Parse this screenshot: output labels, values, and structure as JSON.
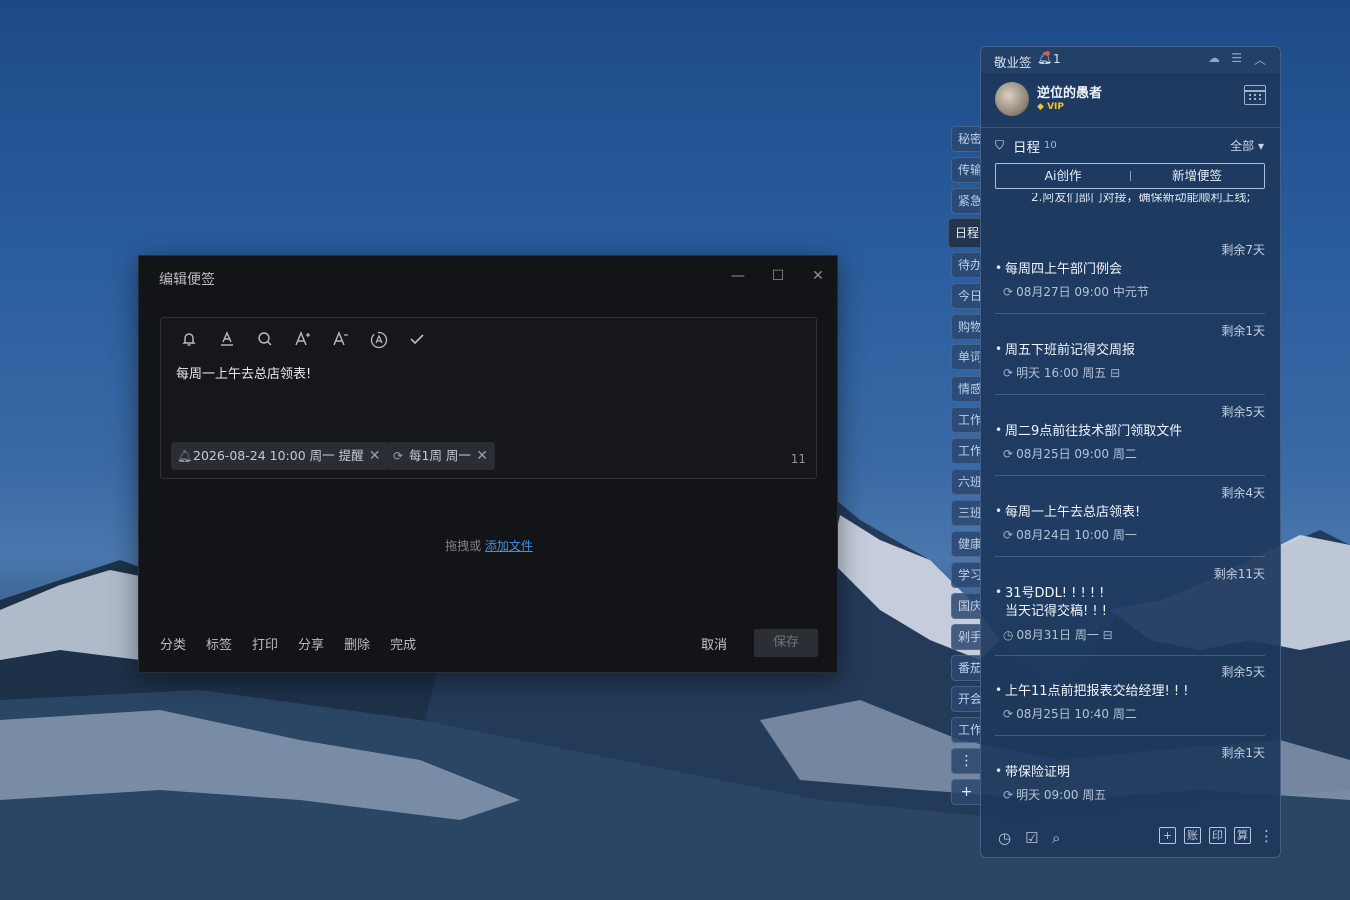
{
  "editor": {
    "title": "编辑便签",
    "minimize_icon": "minimize-icon",
    "maximize_icon": "maximize-icon",
    "close_icon": "close-icon",
    "toolbar": [
      "bell-icon",
      "text-underline-icon",
      "search-icon",
      "font-increase-icon",
      "font-decrease-icon",
      "ai-circle-icon",
      "check-icon"
    ],
    "content": "每周一上午去总店领表!",
    "reminder_chip": "2026-08-24 10:00 周一 提醒",
    "repeat_chip": "每1周 周一",
    "char_count": "11",
    "drop_hint": "拖拽或",
    "add_file_link": "添加文件",
    "actions": [
      "分类",
      "标签",
      "打印",
      "分享",
      "删除",
      "完成"
    ],
    "cancel_label": "取消",
    "save_label": "保存"
  },
  "side_tabs": [
    "秘密",
    "传输",
    "紧急",
    "日程",
    "待办",
    "今日",
    "购物",
    "单词",
    "情感",
    "工作",
    "工作",
    "六班",
    "三班",
    "健康",
    "学习",
    "国庆",
    "剁手",
    "番茄",
    "开会",
    "工作",
    "⋮",
    "+"
  ],
  "side_tab_active": "日程",
  "panel": {
    "app_name": "敬业签",
    "notification_count": "1",
    "username": "逆位的愚者",
    "vip_label": "VIP",
    "schedule_label": "日程",
    "schedule_count": "10",
    "filter_label": "全部",
    "ai_button": "Ai创作",
    "new_note_button": "新增便签",
    "truncated_text": "2.阿友们部门对接，确保新动能顺利上线;",
    "items": [
      {
        "remain": "剩余7天",
        "title": "每周四上午部门例会",
        "meta": "08月27日 09:00 中元节",
        "icon": "repeat"
      },
      {
        "remain": "剩余1天",
        "title": "周五下班前记得交周报",
        "meta": "明天 16:00 周五",
        "icon": "repeat"
      },
      {
        "remain": "剩余5天",
        "title": "周二9点前往技术部门领取文件",
        "meta": "08月25日 09:00 周二",
        "icon": "repeat"
      },
      {
        "remain": "剩余4天",
        "title": "每周一上午去总店领表!",
        "meta": "08月24日 10:00 周一",
        "icon": "repeat"
      },
      {
        "remain": "剩余11天",
        "title": "31号DDL! ! ! ! !",
        "title2": "当天记得交稿! ! !",
        "meta": "08月31日 周一",
        "icon": "clock"
      },
      {
        "remain": "剩余5天",
        "title": "上午11点前把报表交给经理! ! !",
        "meta": "08月25日 10:40 周二",
        "icon": "repeat"
      },
      {
        "remain": "剩余1天",
        "title": "带保险证明",
        "meta": "明天 09:00 周五",
        "icon": "repeat"
      }
    ],
    "footer_left": [
      "clock-icon",
      "calendar-check-icon",
      "search-icon"
    ],
    "footer_right": [
      "+",
      "账",
      "印",
      "算"
    ]
  }
}
